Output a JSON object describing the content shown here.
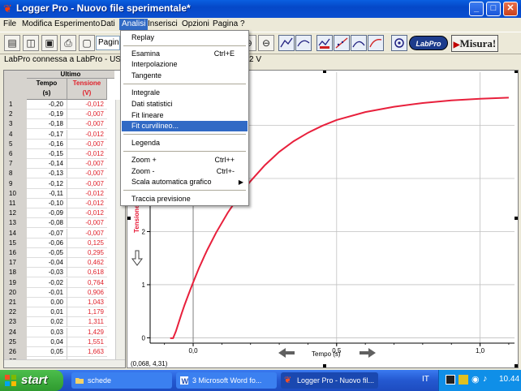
{
  "window": {
    "title": "Logger Pro - Nuovo file sperimentale*"
  },
  "menubar": {
    "items": [
      "File",
      "Modifica",
      "Esperimento",
      "Dati",
      "Analisi",
      "Inserisci",
      "Opzioni",
      "Pagina",
      "?"
    ]
  },
  "toolbar": {
    "page_value": "Pagina 1",
    "labpro_label": "LabPro",
    "misura_label": "Misura!"
  },
  "status": {
    "connection": "LabPro connessa a LabPro - USB",
    "channel_readout": "2 V"
  },
  "table": {
    "group_header": "Ultimo",
    "col_time": "Tempo",
    "col_time_unit": "(s)",
    "col_voltage": "Tensione",
    "col_voltage_unit": "(V)",
    "rows": [
      {
        "n": "1",
        "t": "-0,20",
        "v": "-0,012"
      },
      {
        "n": "2",
        "t": "-0,19",
        "v": "-0,007"
      },
      {
        "n": "3",
        "t": "-0,18",
        "v": "-0,007"
      },
      {
        "n": "4",
        "t": "-0,17",
        "v": "-0,012"
      },
      {
        "n": "5",
        "t": "-0,16",
        "v": "-0,007"
      },
      {
        "n": "6",
        "t": "-0,15",
        "v": "-0,012"
      },
      {
        "n": "7",
        "t": "-0,14",
        "v": "-0,007"
      },
      {
        "n": "8",
        "t": "-0,13",
        "v": "-0,007"
      },
      {
        "n": "9",
        "t": "-0,12",
        "v": "-0,007"
      },
      {
        "n": "10",
        "t": "-0,11",
        "v": "-0,012"
      },
      {
        "n": "11",
        "t": "-0,10",
        "v": "-0,012"
      },
      {
        "n": "12",
        "t": "-0,09",
        "v": "-0,012"
      },
      {
        "n": "13",
        "t": "-0,08",
        "v": "-0,007"
      },
      {
        "n": "14",
        "t": "-0,07",
        "v": "-0,007"
      },
      {
        "n": "15",
        "t": "-0,06",
        "v": "0,125"
      },
      {
        "n": "16",
        "t": "-0,05",
        "v": "0,295"
      },
      {
        "n": "17",
        "t": "-0,04",
        "v": "0,462"
      },
      {
        "n": "18",
        "t": "-0,03",
        "v": "0,618"
      },
      {
        "n": "19",
        "t": "-0,02",
        "v": "0,764"
      },
      {
        "n": "20",
        "t": "-0,01",
        "v": "0,906"
      },
      {
        "n": "21",
        "t": "0,00",
        "v": "1,043"
      },
      {
        "n": "22",
        "t": "0,01",
        "v": "1,179"
      },
      {
        "n": "23",
        "t": "0,02",
        "v": "1,311"
      },
      {
        "n": "24",
        "t": "0,03",
        "v": "1,429"
      },
      {
        "n": "25",
        "t": "0,04",
        "v": "1,551"
      },
      {
        "n": "26",
        "t": "0,05",
        "v": "1,663"
      },
      {
        "n": "27",
        "t": "",
        "v": ""
      }
    ]
  },
  "graph": {
    "x_label": "Tempo (s)",
    "y_label": "Tensione",
    "coord_readout": "(0,068, 4,31)",
    "curve_color": "#e8203c",
    "chart_data": {
      "type": "line",
      "xlim": [
        -0.15,
        1.12
      ],
      "ylim": [
        -0.1,
        5.0
      ],
      "x_ticks": [
        "0,0",
        "0,5",
        "1,0"
      ],
      "x_tick_values": [
        0.0,
        0.5,
        1.0
      ],
      "y_ticks": [
        "0",
        "1",
        "2"
      ],
      "y_tick_values": [
        0,
        1,
        2
      ],
      "series": [
        {
          "x": [
            -0.08,
            -0.07,
            -0.06,
            -0.05,
            -0.04,
            -0.03,
            -0.02,
            -0.01,
            0.0,
            0.01,
            0.02,
            0.03,
            0.04,
            0.05,
            0.08,
            0.12,
            0.16,
            0.2,
            0.25,
            0.3,
            0.35,
            0.4,
            0.45,
            0.5,
            0.6,
            0.7,
            0.8,
            0.9,
            1.0,
            1.1
          ],
          "y": [
            -0.007,
            -0.007,
            0.125,
            0.295,
            0.462,
            0.618,
            0.764,
            0.906,
            1.043,
            1.179,
            1.311,
            1.429,
            1.551,
            1.663,
            1.98,
            2.35,
            2.67,
            2.95,
            3.25,
            3.5,
            3.7,
            3.86,
            3.99,
            4.1,
            4.25,
            4.35,
            4.42,
            4.47,
            4.5,
            4.52
          ]
        }
      ]
    }
  },
  "dropdown": {
    "items": [
      {
        "label": "Replay",
        "shortcut": "",
        "arrow": false,
        "highlighted": false
      },
      {
        "label": "Esamina",
        "shortcut": "Ctrl+E",
        "arrow": false,
        "highlighted": false
      },
      {
        "label": "Interpolazione",
        "shortcut": "",
        "arrow": false,
        "highlighted": false
      },
      {
        "label": "Tangente",
        "shortcut": "",
        "arrow": false,
        "highlighted": false
      },
      {
        "label": "Integrale",
        "shortcut": "",
        "arrow": false,
        "highlighted": false
      },
      {
        "label": "Dati statistici",
        "shortcut": "",
        "arrow": false,
        "highlighted": false
      },
      {
        "label": "Fit lineare",
        "shortcut": "",
        "arrow": false,
        "highlighted": false
      },
      {
        "label": "Fit curvilineo...",
        "shortcut": "",
        "arrow": false,
        "highlighted": true
      },
      {
        "label": "Legenda",
        "shortcut": "",
        "arrow": false,
        "highlighted": false
      },
      {
        "label": "Zoom +",
        "shortcut": "Ctrl++",
        "arrow": false,
        "highlighted": false
      },
      {
        "label": "Zoom -",
        "shortcut": "Ctrl+-",
        "arrow": false,
        "highlighted": false
      },
      {
        "label": "Scala automatica grafico",
        "shortcut": "",
        "arrow": true,
        "highlighted": false
      },
      {
        "label": "Traccia previsione",
        "shortcut": "",
        "arrow": false,
        "highlighted": false
      }
    ]
  },
  "taskbar": {
    "start_label": "start",
    "tasks": [
      "schede",
      "3 Microsoft Word fo...",
      "Logger Pro - Nuovo fil..."
    ],
    "language": "IT",
    "clock": "10.44"
  }
}
